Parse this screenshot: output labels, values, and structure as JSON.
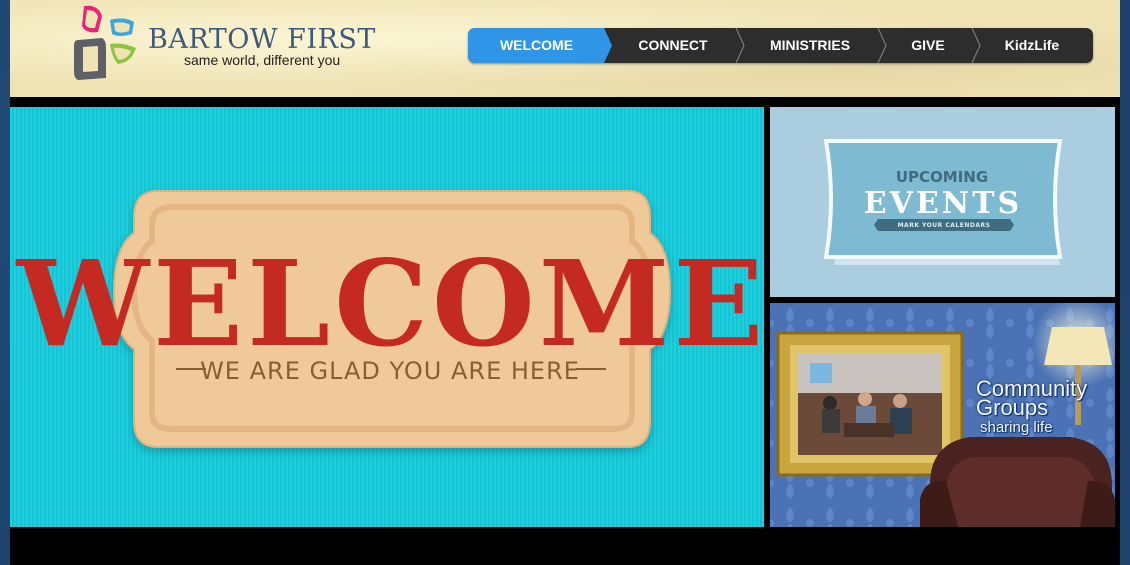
{
  "brand": {
    "name": "BARTOW FIRST",
    "tagline": "same world, different you",
    "colors": {
      "pink": "#e8237a",
      "blue": "#3aa7dc",
      "green": "#8cc63f",
      "gray": "#5d6167"
    }
  },
  "nav": {
    "items": [
      {
        "label": "WELCOME",
        "active": true
      },
      {
        "label": "CONNECT",
        "active": false
      },
      {
        "label": "MINISTRIES",
        "active": false
      },
      {
        "label": "GIVE",
        "active": false
      },
      {
        "label": "KidzLife",
        "active": false
      }
    ],
    "colors": {
      "bar": "#2d2d2d",
      "active": "#2f95e6"
    }
  },
  "welcome_banner": {
    "title": "WELCOME",
    "subtitle": "WE ARE GLAD YOU ARE HERE",
    "colors": {
      "background": "#14cbdb",
      "sign": "#f0c99a",
      "title": "#c42a22",
      "subtitle": "#8a5e34"
    }
  },
  "events_banner": {
    "kicker": "UPCOMING",
    "title": "EVENTS",
    "ribbon": "MARK YOUR CALENDARS",
    "colors": {
      "background": "#aacde0",
      "sign": "#7fbad3"
    }
  },
  "groups_banner": {
    "title_line1": "Community",
    "title_line2": "Groups",
    "subtitle": "sharing life",
    "icons": [
      "picture-frame-icon",
      "lamp-icon",
      "armchair-icon"
    ]
  }
}
